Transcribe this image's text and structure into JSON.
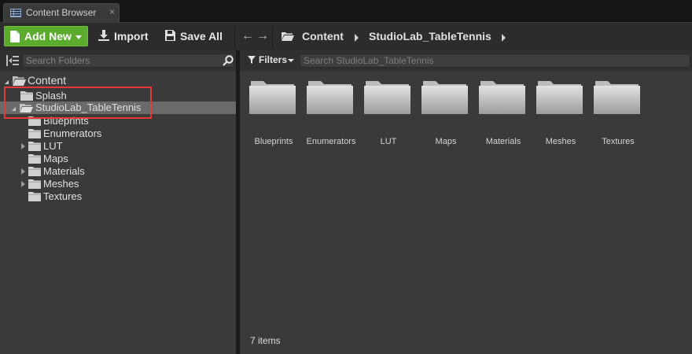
{
  "tab": {
    "title": "Content Browser",
    "close": "×"
  },
  "toolbar": {
    "add_new": "Add New",
    "import": "Import",
    "save_all": "Save All"
  },
  "breadcrumb": [
    "Content",
    "StudioLab_TableTennis"
  ],
  "folders_search": {
    "placeholder": "Search Folders"
  },
  "tree": {
    "root": "Content",
    "items": [
      {
        "label": "Splash"
      },
      {
        "label": "StudioLab_TableTennis",
        "selected": true
      },
      {
        "label": "Blueprints"
      },
      {
        "label": "Enumerators"
      },
      {
        "label": "LUT",
        "has_children": true
      },
      {
        "label": "Maps"
      },
      {
        "label": "Materials",
        "has_children": true
      },
      {
        "label": "Meshes",
        "has_children": true
      },
      {
        "label": "Textures"
      }
    ]
  },
  "assets": {
    "filters_label": "Filters",
    "search_placeholder": "Search StudioLab_TableTennis",
    "items": [
      "Blueprints",
      "Enumerators",
      "LUT",
      "Maps",
      "Materials",
      "Meshes",
      "Textures"
    ],
    "count_text": "7 items"
  },
  "colors": {
    "add_new_bg": "#5bac2c",
    "selection": "#6a6a6a",
    "highlight_border": "#e53935"
  }
}
